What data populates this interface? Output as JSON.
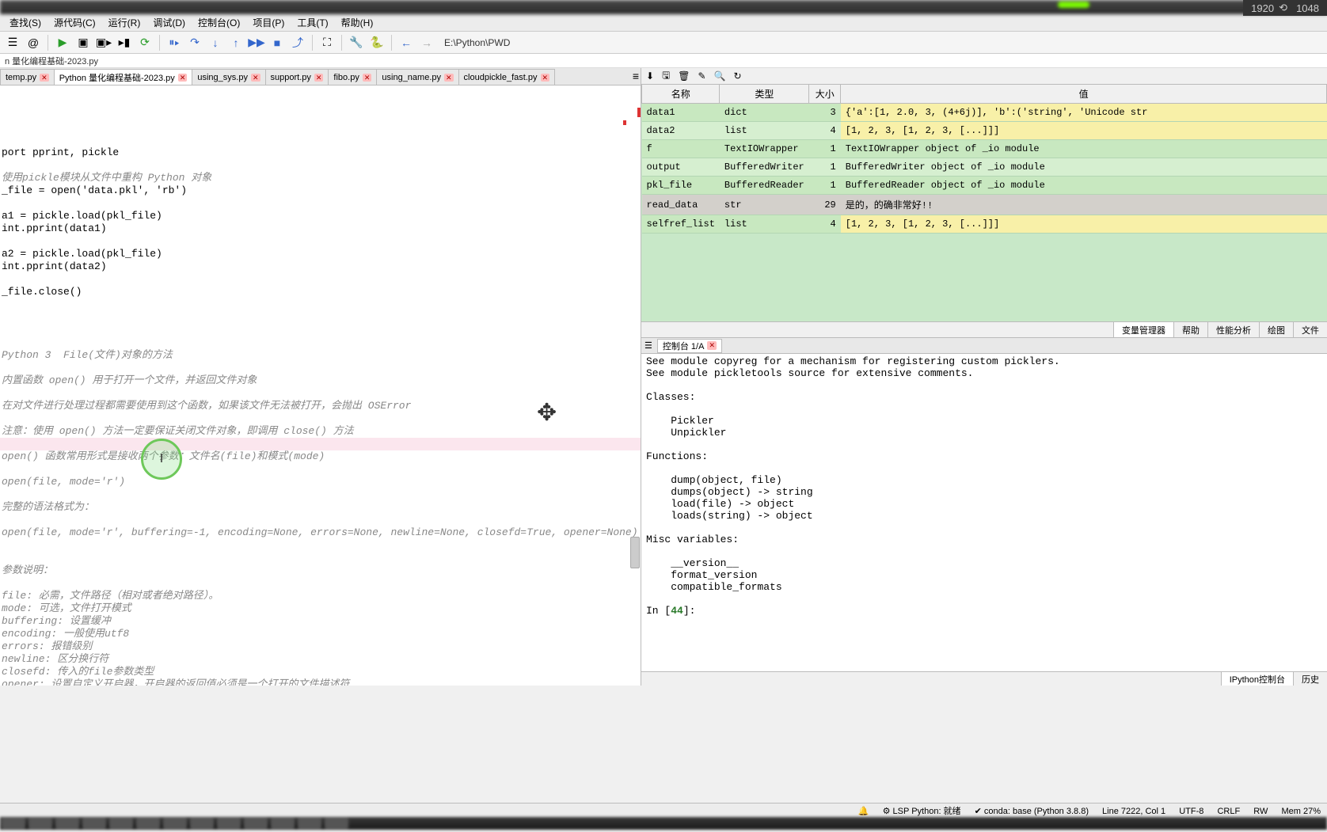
{
  "resolution_badge": "1920 ⟲ 1048",
  "menubar": [
    "查找(S)",
    "源代码(C)",
    "运行(R)",
    "调试(D)",
    "控制台(O)",
    "项目(P)",
    "工具(T)",
    "帮助(H)"
  ],
  "toolbar_path": "E:\\Python\\PWD",
  "filepath": "n 量化编程基础-2023.py",
  "editor_tabs": [
    {
      "label": "temp.py",
      "active": false
    },
    {
      "label": "Python 量化编程基础-2023.py",
      "active": true
    },
    {
      "label": "using_sys.py",
      "active": false
    },
    {
      "label": "support.py",
      "active": false
    },
    {
      "label": "fibo.py",
      "active": false
    },
    {
      "label": "using_name.py",
      "active": false
    },
    {
      "label": "cloudpickle_fast.py",
      "active": false
    }
  ],
  "code": [
    {
      "t": "port pprint, pickle",
      "cls": ""
    },
    {
      "t": "",
      "cls": ""
    },
    {
      "t": "使用pickle模块从文件中重构 Python 对象",
      "cls": "cmt"
    },
    {
      "t": "_file = open('data.pkl', 'rb')",
      "cls": ""
    },
    {
      "t": "",
      "cls": ""
    },
    {
      "t": "a1 = pickle.load(pkl_file)",
      "cls": ""
    },
    {
      "t": "int.pprint(data1)",
      "cls": ""
    },
    {
      "t": "",
      "cls": ""
    },
    {
      "t": "a2 = pickle.load(pkl_file)",
      "cls": ""
    },
    {
      "t": "int.pprint(data2)",
      "cls": ""
    },
    {
      "t": "",
      "cls": ""
    },
    {
      "t": "_file.close()",
      "cls": ""
    },
    {
      "t": "",
      "cls": ""
    },
    {
      "t": "",
      "cls": ""
    },
    {
      "t": "",
      "cls": ""
    },
    {
      "t": "",
      "cls": ""
    },
    {
      "t": "Python 3  File(文件)对象的方法",
      "cls": "cmt"
    },
    {
      "t": "",
      "cls": ""
    },
    {
      "t": "内置函数 open() 用于打开一个文件，并返回文件对象",
      "cls": "cmt"
    },
    {
      "t": "",
      "cls": ""
    },
    {
      "t": "在对文件进行处理过程都需要使用到这个函数，如果该文件无法被打开，会抛出 OSError",
      "cls": "cmt"
    },
    {
      "t": "",
      "cls": ""
    },
    {
      "t": "注意：使用 open() 方法一定要保证关闭文件对象，即调用 close() 方法",
      "cls": "cmt"
    },
    {
      "t": "",
      "cls": "hl"
    },
    {
      "t": "open() 函数常用形式是接收两个参数：文件名(file)和模式(mode)",
      "cls": "cmt"
    },
    {
      "t": "",
      "cls": ""
    },
    {
      "t": "open(file, mode='r')",
      "cls": "cmt"
    },
    {
      "t": "",
      "cls": ""
    },
    {
      "t": "完整的语法格式为：",
      "cls": "cmt"
    },
    {
      "t": "",
      "cls": ""
    },
    {
      "t": "open(file, mode='r', buffering=-1, encoding=None, errors=None, newline=None, closefd=True, opener=None)",
      "cls": "cmt"
    },
    {
      "t": "",
      "cls": ""
    },
    {
      "t": "",
      "cls": ""
    },
    {
      "t": "参数说明：",
      "cls": "cmt"
    },
    {
      "t": "",
      "cls": ""
    },
    {
      "t": "file: 必需，文件路径（相对或者绝对路径）。",
      "cls": "cmt"
    },
    {
      "t": "mode: 可选，文件打开模式",
      "cls": "cmt"
    },
    {
      "t": "buffering: 设置缓冲",
      "cls": "cmt"
    },
    {
      "t": "encoding: 一般使用utf8",
      "cls": "cmt"
    },
    {
      "t": "errors: 报错级别",
      "cls": "cmt"
    },
    {
      "t": "newline: 区分换行符",
      "cls": "cmt"
    },
    {
      "t": "closefd: 传入的file参数类型",
      "cls": "cmt"
    },
    {
      "t": "opener: 设置自定义开启器，开启器的返回值必须是一个打开的文件描述符",
      "cls": "cmt"
    }
  ],
  "var_headers": {
    "name": "名称",
    "type": "类型",
    "size": "大小",
    "value": "值"
  },
  "variables": [
    {
      "name": "data1",
      "type": "dict",
      "size": "3",
      "value": "{'a':[1, 2.0, 3, (4+6j)], 'b':('string', 'Unicode str",
      "yellow": true
    },
    {
      "name": "data2",
      "type": "list",
      "size": "4",
      "value": "[1, 2, 3, [1, 2, 3, [...]]]",
      "yellow": true
    },
    {
      "name": "f",
      "type": "TextIOWrapper",
      "size": "1",
      "value": "TextIOWrapper object of _io module"
    },
    {
      "name": "output",
      "type": "BufferedWriter",
      "size": "1",
      "value": "BufferedWriter object of _io module"
    },
    {
      "name": "pkl_file",
      "type": "BufferedReader",
      "size": "1",
      "value": "BufferedReader object of _io module"
    },
    {
      "name": "read_data",
      "type": "str",
      "size": "29",
      "value": "是的，的确非常好!!",
      "grey": true
    },
    {
      "name": "selfref_list",
      "type": "list",
      "size": "4",
      "value": "[1, 2, 3, [1, 2, 3, [...]]]",
      "yellow": true
    }
  ],
  "var_bottom_tabs": [
    "变量管理器",
    "帮助",
    "性能分析",
    "绘图",
    "文件"
  ],
  "console_tab": "控制台 1/A",
  "console_lines": [
    "See module copyreg for a mechanism for registering custom picklers.",
    "See module pickletools source for extensive comments.",
    "",
    "Classes:",
    "",
    "    Pickler",
    "    Unpickler",
    "",
    "Functions:",
    "",
    "    dump(object, file)",
    "    dumps(object) -> string",
    "    load(file) -> object",
    "    loads(string) -> object",
    "",
    "Misc variables:",
    "",
    "    __version__",
    "    format_version",
    "    compatible_formats",
    ""
  ],
  "console_prompt_pre": "In [",
  "console_prompt_num": "44",
  "console_prompt_post": "]:",
  "console_bottom_tabs": [
    "IPython控制台",
    "历史"
  ],
  "statusbar": {
    "left": "",
    "items": [
      "🔔",
      "⚙ LSP Python: 就绪",
      "✔ conda: base (Python 3.8.8)",
      "Line 7222, Col 1",
      "UTF-8",
      "CRLF",
      "RW",
      "Mem 27%"
    ]
  }
}
